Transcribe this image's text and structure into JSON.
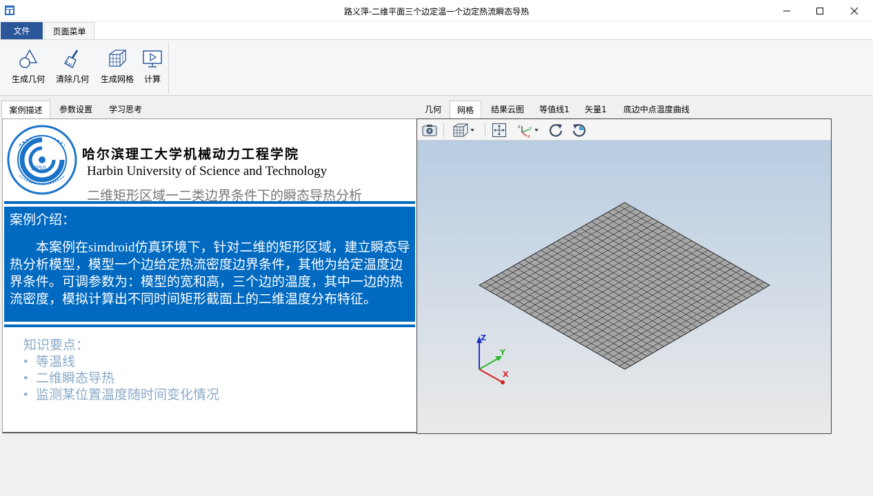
{
  "window": {
    "title": "路义萍-二维平面三个边定温一个边定热流瞬态导热",
    "minimize_icon": "minimize-icon",
    "maximize_icon": "maximize-icon",
    "close_icon": "close-icon"
  },
  "ribbon": {
    "tabs": [
      {
        "label": "文件"
      },
      {
        "label": "页面菜单"
      }
    ],
    "buttons": [
      {
        "label": "生成几何",
        "icon": "geometry-icon"
      },
      {
        "label": "清除几何",
        "icon": "broom-icon"
      },
      {
        "label": "生成网格",
        "icon": "mesh-cube-icon"
      },
      {
        "label": "计算",
        "icon": "compute-monitor-icon"
      }
    ]
  },
  "left": {
    "tabs": [
      {
        "label": "案例描述"
      },
      {
        "label": "参数设置"
      },
      {
        "label": "学习思考"
      }
    ],
    "school_cn": "哈尔滨理工大学机械动力工程学院",
    "school_en": "Harbin University of Science and Technology",
    "case_title": "二维矩形区域一二类边界条件下的瞬态导热分析",
    "seal_year": "1950",
    "intro_heading": "案例介绍：",
    "intro_body": "本案例在simdroid仿真环境下，针对二维的矩形区域，建立瞬态导热分析模型，模型一个边给定热流密度边界条件，其他为给定温度边界条件。可调参数为：模型的宽和高，三个边的温度，其中一边的热流密度，模拟计算出不同时间矩形截面上的二维温度分布特征。",
    "knowledge_heading": "知识要点：",
    "knowledge_items": [
      "等温线",
      "二维瞬态导热",
      "监测某位置温度随时间变化情况"
    ]
  },
  "right": {
    "tabs": [
      {
        "label": "几何"
      },
      {
        "label": "网格"
      },
      {
        "label": "结果云图"
      },
      {
        "label": "等值线1"
      },
      {
        "label": "矢量1"
      },
      {
        "label": "底边中点温度曲线"
      }
    ],
    "active_tab": "网格",
    "toolbar_icons": [
      "camera-icon",
      "view-cube-icon",
      "fit-view-icon",
      "axes-orient-icon",
      "rotate-cw-icon",
      "rotate-ccw-icon"
    ],
    "axes": {
      "x": "X",
      "y": "Y",
      "z": "Z"
    },
    "mesh": {
      "divisions": 26,
      "fill": "#a6a6a6",
      "line": "#222222"
    }
  },
  "colors": {
    "accent_blue": "#0069c0",
    "file_tab": "#2b579a",
    "knowledge_text": "#8aa9c8"
  }
}
